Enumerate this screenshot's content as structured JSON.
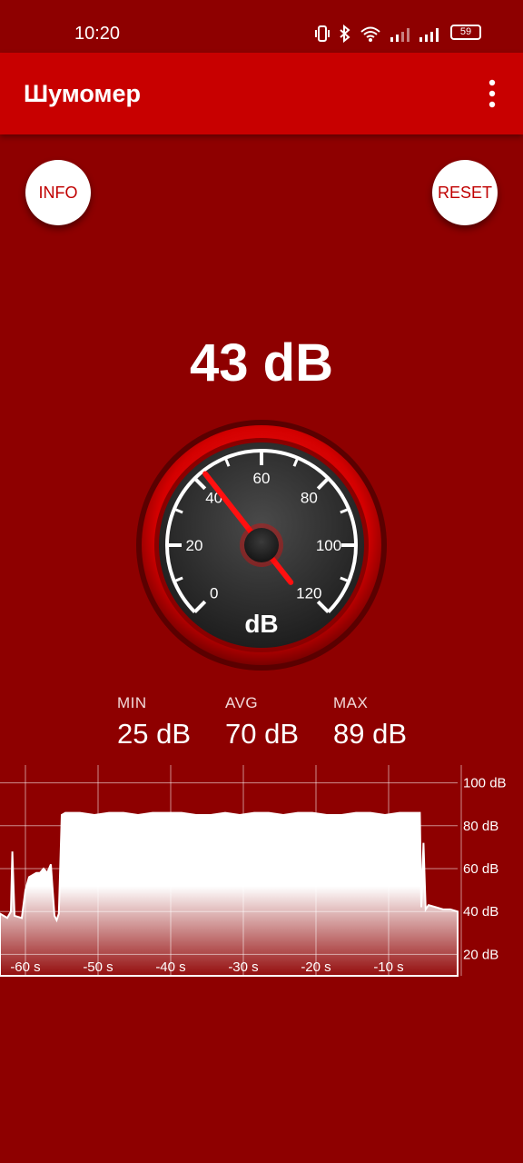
{
  "status_bar": {
    "time": "10:20",
    "battery": "59"
  },
  "app_bar": {
    "title": "Шумомер",
    "menu_icon": "more-vert-icon"
  },
  "buttons": {
    "info": "INFO",
    "reset": "RESET"
  },
  "current_level": "43 dB",
  "gauge": {
    "value": 43,
    "min": 0,
    "max": 120,
    "unit": "dB",
    "labels": [
      "0",
      "20",
      "40",
      "60",
      "80",
      "100",
      "120"
    ]
  },
  "stats": {
    "min_label": "MIN",
    "min_value": "25 dB",
    "avg_label": "AVG",
    "avg_value": "70 dB",
    "max_label": "MAX",
    "max_value": "89 dB"
  },
  "chart_data": {
    "type": "area",
    "x_tick_labels": [
      "-60 s",
      "-50 s",
      "-40 s",
      "-30 s",
      "-20 s",
      "-10 s"
    ],
    "y_tick_labels": [
      "100 dB",
      "80 dB",
      "60 dB",
      "40 dB",
      "20 dB"
    ],
    "x_unit": "s",
    "y_unit": "dB",
    "xlim": [
      -63,
      0
    ],
    "ylim": [
      10,
      110
    ],
    "series": [
      {
        "x": [
          -63,
          -62,
          -61.5,
          -61.3,
          -61,
          -60,
          -59.5,
          -59,
          -58,
          -57.5,
          -57,
          -56.5,
          -56,
          -55.5,
          -55.2,
          -54.9,
          -54.5,
          -54,
          -52,
          -50,
          -48,
          -46,
          -44,
          -42,
          -40,
          -38,
          -36,
          -34,
          -32,
          -30,
          -28,
          -26,
          -24,
          -22,
          -20,
          -18,
          -16,
          -14,
          -12,
          -10,
          -8,
          -6,
          -5.5,
          -5.2,
          -5,
          -4.7,
          -4.4,
          -4,
          -3,
          -2,
          -1,
          0
        ],
        "y": [
          39,
          37,
          40,
          68,
          38,
          37,
          50,
          56,
          58,
          58,
          60,
          58,
          62,
          38,
          36,
          39,
          85,
          86,
          86,
          85,
          86,
          86,
          85,
          86,
          86,
          86,
          85,
          85,
          86,
          85,
          86,
          86,
          85,
          86,
          86,
          85,
          85,
          86,
          86,
          85,
          86,
          86,
          86,
          86,
          42,
          72,
          41,
          43,
          42,
          41,
          41,
          40
        ]
      }
    ],
    "grid": true
  },
  "colors": {
    "background": "#8e0000",
    "appbar": "#c80000",
    "accent": "#ff1a1a"
  }
}
